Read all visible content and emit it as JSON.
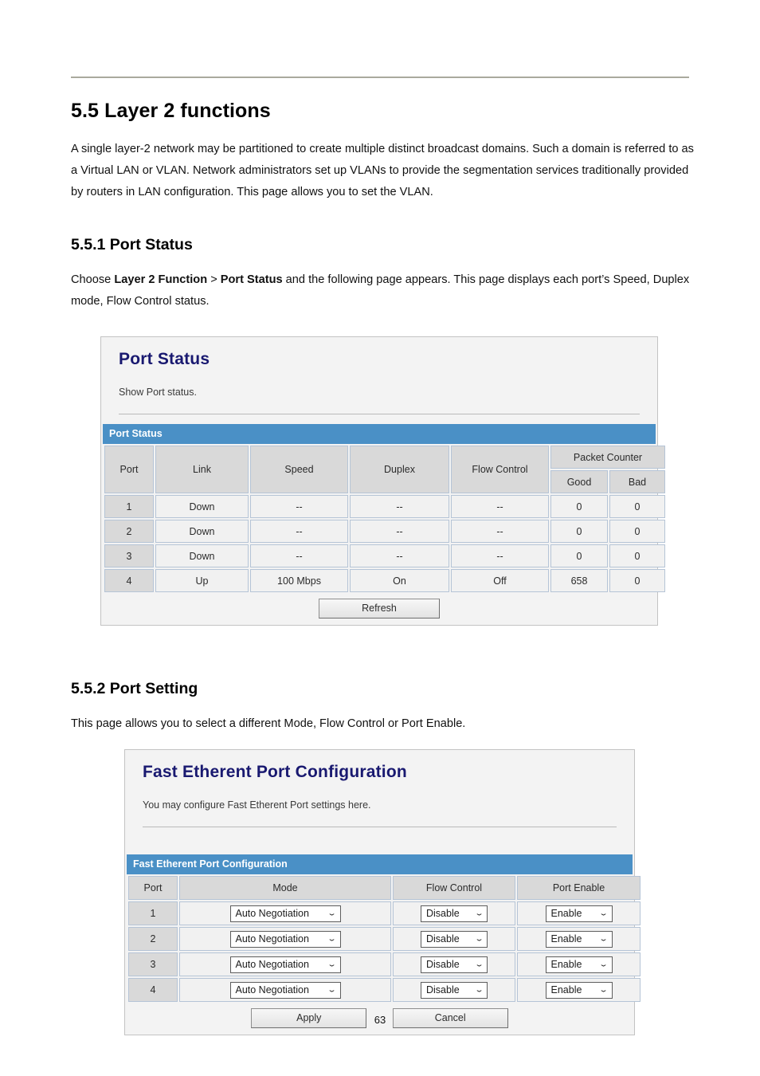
{
  "document": {
    "page_number": "63"
  },
  "sections": [
    {
      "heading": "5.5 Layer 2 functions",
      "paragraph": "A single layer-2 network may be partitioned to create multiple distinct broadcast domains. Such a domain is referred to as a Virtual LAN or VLAN. Network administrators set up VLANs to provide the segmentation services traditionally provided by routers in LAN configuration. This page allows you to set the VLAN."
    }
  ],
  "subsection_1": {
    "heading": "5.5.1 Port Status",
    "intro_prefix": "Choose ",
    "intro_bold_1": "Layer 2 Function",
    "intro_mid": " > ",
    "intro_bold_2": "Port Status",
    "intro_suffix": " and the following page appears. This page displays each port’s Speed, Duplex mode, Flow Control status."
  },
  "subsection_2": {
    "heading": "5.5.2 Port Setting",
    "intro": "This page allows you to select a different Mode, Flow Control or Port Enable."
  },
  "port_status_panel": {
    "title": "Port Status",
    "description": "Show Port status.",
    "section_bar": "Port Status",
    "headers": {
      "port": "Port",
      "link": "Link",
      "speed": "Speed",
      "duplex": "Duplex",
      "flow_control": "Flow Control",
      "packet_counter": "Packet Counter",
      "good": "Good",
      "bad": "Bad"
    },
    "rows": [
      {
        "port": "1",
        "link": "Down",
        "speed": "--",
        "duplex": "--",
        "flow_control": "--",
        "good": "0",
        "bad": "0"
      },
      {
        "port": "2",
        "link": "Down",
        "speed": "--",
        "duplex": "--",
        "flow_control": "--",
        "good": "0",
        "bad": "0"
      },
      {
        "port": "3",
        "link": "Down",
        "speed": "--",
        "duplex": "--",
        "flow_control": "--",
        "good": "0",
        "bad": "0"
      },
      {
        "port": "4",
        "link": "Up",
        "speed": "100 Mbps",
        "duplex": "On",
        "flow_control": "Off",
        "good": "658",
        "bad": "0"
      }
    ],
    "refresh_button": "Refresh"
  },
  "port_setting_panel": {
    "title": "Fast Etherent Port Configuration",
    "description": "You may configure Fast Etherent Port settings here.",
    "section_bar": "Fast Etherent Port Configuration",
    "headers": {
      "port": "Port",
      "mode": "Mode",
      "flow_control": "Flow Control",
      "port_enable": "Port Enable"
    },
    "rows": [
      {
        "port": "1",
        "mode": "Auto Negotiation",
        "flow_control": "Disable",
        "port_enable": "Enable"
      },
      {
        "port": "2",
        "mode": "Auto Negotiation",
        "flow_control": "Disable",
        "port_enable": "Enable"
      },
      {
        "port": "3",
        "mode": "Auto Negotiation",
        "flow_control": "Disable",
        "port_enable": "Enable"
      },
      {
        "port": "4",
        "mode": "Auto Negotiation",
        "flow_control": "Disable",
        "port_enable": "Enable"
      }
    ],
    "apply_button": "Apply",
    "cancel_button": "Cancel",
    "chevron": "⌄"
  },
  "colors": {
    "heading_blue": "#191970",
    "bar_blue": "#4a90c6",
    "rule_gray": "#a9a99d",
    "panel_bg": "#f3f3f3",
    "header_cell": "#d9d9d9",
    "data_cell": "#f1f1f1",
    "cell_border": "#b5c4d6"
  }
}
